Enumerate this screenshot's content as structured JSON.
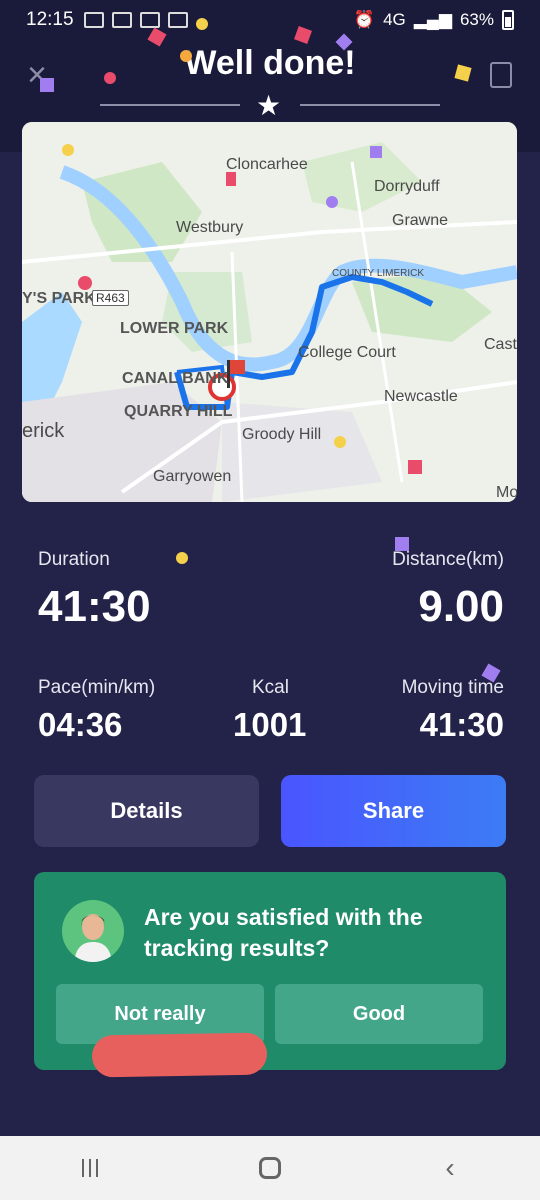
{
  "status_bar": {
    "time": "12:15",
    "battery": "63%",
    "network": "4G"
  },
  "header": {
    "title": "Well done!"
  },
  "map": {
    "labels": [
      "Cloncarhee",
      "Dorryduff",
      "Westbury",
      "Grawne",
      "COUNTY LIMERICK",
      "Y'S PARK",
      "R463",
      "LOWER PARK",
      "College Court",
      "Cast",
      "CANAL BANK",
      "Newcastle",
      "QUARRY HILL",
      "erick",
      "Groody Hill",
      "Garryowen",
      "Mo"
    ]
  },
  "stats": {
    "duration_label": "Duration",
    "duration_value": "41:30",
    "distance_label": "Distance(km)",
    "distance_value": "9.00",
    "pace_label": "Pace(min/km)",
    "pace_value": "04:36",
    "kcal_label": "Kcal",
    "kcal_value": "1001",
    "moving_label": "Moving time",
    "moving_value": "41:30"
  },
  "actions": {
    "details_label": "Details",
    "share_label": "Share"
  },
  "survey": {
    "question": "Are you satisfied with the tracking results?",
    "not_really_label": "Not really",
    "good_label": "Good"
  },
  "colors": {
    "accent": "#4a55ff",
    "survey_bg": "#1f8b68",
    "route": "#1a73e8"
  }
}
